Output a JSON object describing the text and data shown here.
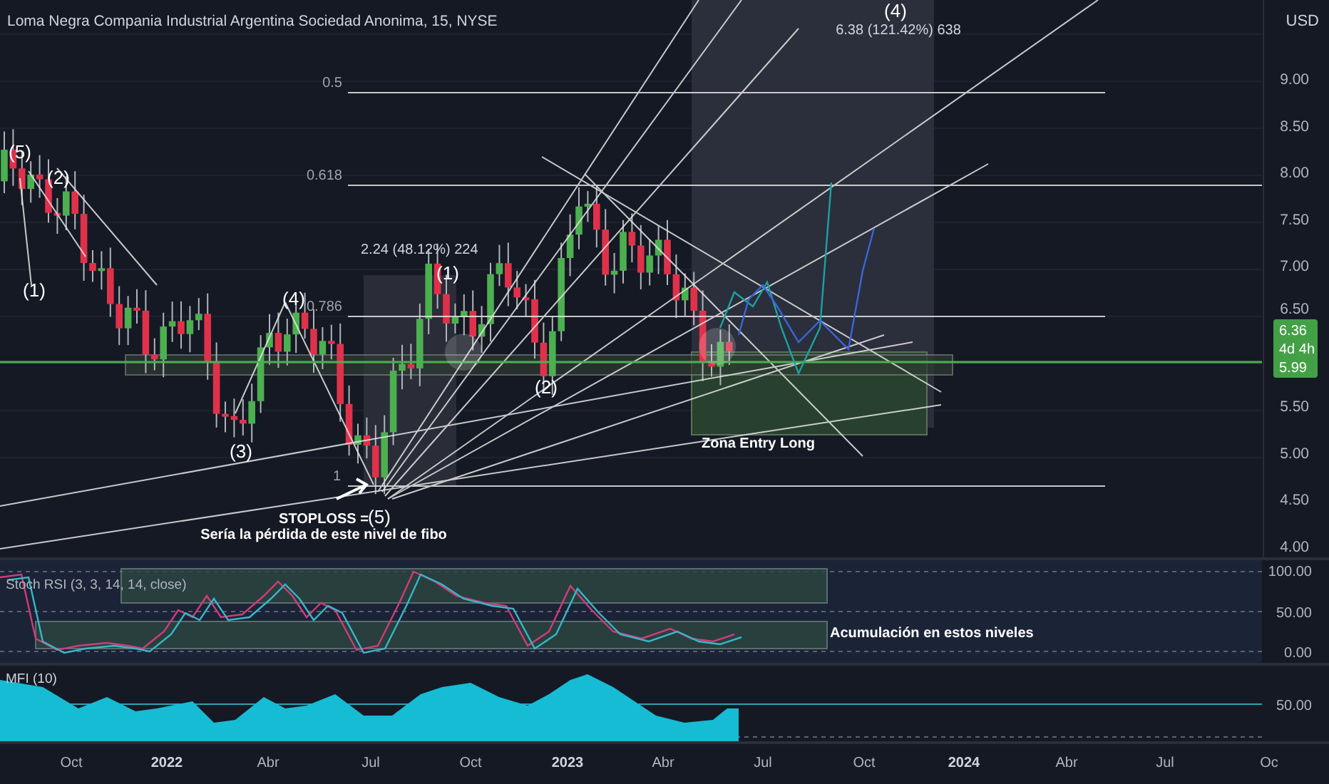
{
  "chart_title": "Loma Negra Compania Industrial Argentina Sociedad Anonima, 15, NYSE",
  "currency": "USD",
  "fib_levels": [
    {
      "label": "0.5"
    },
    {
      "label": "0.618"
    },
    {
      "label": "0.786"
    },
    {
      "label": "1"
    }
  ],
  "measurements": [
    "2.24 (48.12%) 224",
    "6.38 (121.42%) 638"
  ],
  "wave_labels": [
    "(5)",
    "(2)",
    "(1)",
    "(4)",
    "(3)",
    "(5)",
    "(1)",
    "(2)",
    "(4)"
  ],
  "notes": [
    {
      "kind": "stoploss",
      "title": "STOPLOSS =",
      "text": "Sería la pérdida de este nivel de fibo"
    },
    {
      "kind": "zone",
      "text": "Zona Entry Long"
    }
  ],
  "price_axis": [
    "9.00",
    "8.50",
    "8.00",
    "7.50",
    "7.00",
    "6.50",
    "5.50",
    "5.00",
    "4.50",
    "4.00"
  ],
  "price_tag": [
    "6.36",
    "4d 4h",
    "5.99"
  ],
  "stoch_rsi": {
    "title": "Stoch RSI (3, 3, 14, 14, close)",
    "note": "Acumulación en estos niveles",
    "axis": [
      "100.00",
      "50.00",
      "0.00"
    ]
  },
  "mfi": {
    "title": "MFI (10)",
    "axis": [
      "50.00"
    ]
  },
  "time_axis": [
    {
      "label": "Oct",
      "kind": "month"
    },
    {
      "label": "2022",
      "kind": "year"
    },
    {
      "label": "Abr",
      "kind": "month"
    },
    {
      "label": "Jul",
      "kind": "month"
    },
    {
      "label": "Oct",
      "kind": "month"
    },
    {
      "label": "2023",
      "kind": "year"
    },
    {
      "label": "Abr",
      "kind": "month"
    },
    {
      "label": "Jul",
      "kind": "month"
    },
    {
      "label": "Oct",
      "kind": "month"
    },
    {
      "label": "2024",
      "kind": "year"
    },
    {
      "label": "Abr",
      "kind": "month"
    },
    {
      "label": "Jul",
      "kind": "month"
    },
    {
      "label": "Oc",
      "kind": "month"
    }
  ]
}
